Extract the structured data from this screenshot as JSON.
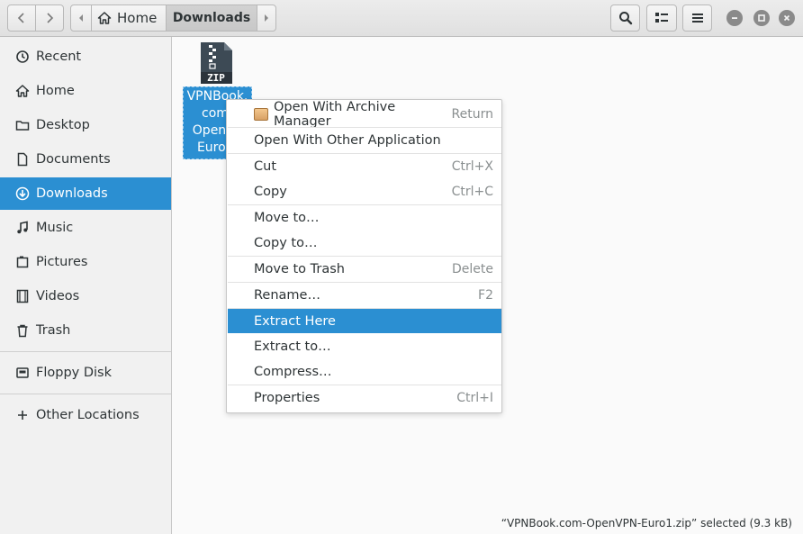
{
  "header": {
    "path": {
      "home_label": "Home",
      "current_label": "Downloads"
    }
  },
  "sidebar": {
    "items": [
      {
        "label": "Recent",
        "icon": "clock-icon"
      },
      {
        "label": "Home",
        "icon": "home-icon"
      },
      {
        "label": "Desktop",
        "icon": "folder-icon"
      },
      {
        "label": "Documents",
        "icon": "document-icon"
      },
      {
        "label": "Downloads",
        "icon": "download-icon",
        "active": true
      },
      {
        "label": "Music",
        "icon": "music-note-icon"
      },
      {
        "label": "Pictures",
        "icon": "picture-icon"
      },
      {
        "label": "Videos",
        "icon": "film-icon"
      },
      {
        "label": "Trash",
        "icon": "trash-icon"
      },
      {
        "label": "Floppy Disk",
        "icon": "drive-icon"
      },
      {
        "label": "Other Locations",
        "icon": "plus-icon"
      }
    ]
  },
  "file": {
    "badge": "ZIP",
    "label_lines": [
      "VPNBook.",
      "com-",
      "OpenVP",
      "Euro1."
    ]
  },
  "context_menu": {
    "items": [
      {
        "label": "Open With Archive Manager",
        "accel": "Return"
      },
      {
        "label": "Open With Other Application",
        "accel": ""
      },
      {
        "label": "Cut",
        "accel": "Ctrl+X"
      },
      {
        "label": "Copy",
        "accel": "Ctrl+C"
      },
      {
        "label": "Move to…",
        "accel": ""
      },
      {
        "label": "Copy to…",
        "accel": ""
      },
      {
        "label": "Move to Trash",
        "accel": "Delete"
      },
      {
        "label": "Rename…",
        "accel": "F2"
      },
      {
        "label": "Extract Here",
        "accel": ""
      },
      {
        "label": "Extract to…",
        "accel": ""
      },
      {
        "label": "Compress…",
        "accel": ""
      },
      {
        "label": "Properties",
        "accel": "Ctrl+I"
      }
    ]
  },
  "status": {
    "text": "“VPNBook.com-OpenVPN-Euro1.zip” selected  (9.3 kB)"
  },
  "colors": {
    "accent": "#2b8fd2"
  }
}
